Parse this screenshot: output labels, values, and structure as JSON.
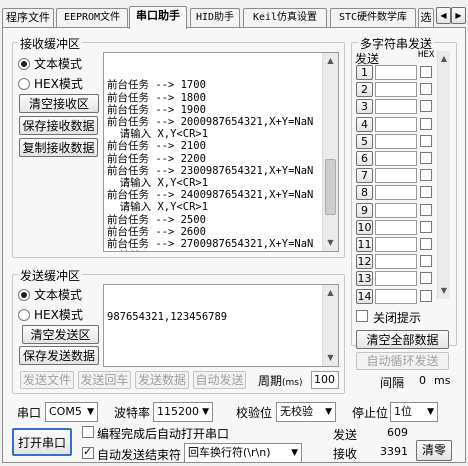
{
  "tabs": [
    "程序文件",
    "EEPROM文件",
    "串口助手",
    "HID助手",
    "Keil仿真设置",
    "STC硬件数学库",
    "选"
  ],
  "tab_nav_arrows": [
    "◀",
    "▶"
  ],
  "receive": {
    "title": "接收缓冲区",
    "mode_text": "文本模式",
    "mode_hex": "HEX模式",
    "clear_label": "清空接收区",
    "save_label": "保存接收数据",
    "copy_label": "复制接收数据",
    "content": "前台任务 --> 1700\n前台任务 --> 1800\n前台任务 --> 1900\n前台任务 --> 2000987654321,X+Y=NaN\n  请输入 X,Y<CR>1\n前台任务 --> 2100\n前台任务 --> 2200\n前台任务 --> 2300987654321,X+Y=NaN\n  请输入 X,Y<CR>1\n前台任务 --> 2400987654321,X+Y=NaN\n  请输入 X,Y<CR>1\n前台任务 --> 2500\n前台任务 --> 2600\n前台任务 --> 2700987654321,X+Y=NaN\n  请输入 X,Y<CR>1\n前台任务 --> 2800"
  },
  "send": {
    "title": "发送缓冲区",
    "mode_text": "文本模式",
    "mode_hex": "HEX模式",
    "clear_label": "清空发送区",
    "save_label": "保存发送数据",
    "content": "987654321,123456789",
    "send_file": "发送文件",
    "send_enter": "发送回车",
    "send_data": "发送数据",
    "auto_send": "自动发送",
    "period_label": "周期",
    "period_unit": "(ms)",
    "period_value": "100"
  },
  "multi": {
    "title": "多字符串发送",
    "col_send": "发送",
    "col_hex": "HEX",
    "rows": [
      "1",
      "2",
      "3",
      "4",
      "5",
      "6",
      "7",
      "8",
      "9",
      "10",
      "11",
      "12",
      "13",
      "14"
    ],
    "close_tip": "关闭提示",
    "clear_all": "清空全部数据",
    "auto_loop": "自动循环发送",
    "interval_label": "间隔",
    "interval_value": "0",
    "interval_unit": "ms"
  },
  "bottom": {
    "port_label": "串口",
    "port_value": "COM5",
    "baud_label": "波特率",
    "baud_value": "115200",
    "parity_label": "校验位",
    "parity_value": "无校验",
    "stop_label": "停止位",
    "stop_value": "1位",
    "open_port": "打开串口",
    "auto_open": "编程完成后自动打开串口",
    "auto_end": "自动发送结束符",
    "end_value": "回车换行符(\\r\\n)",
    "sent_label": "发送",
    "sent_value": "609",
    "recv_label": "接收",
    "recv_value": "3391",
    "clear_count": "清零"
  },
  "scroll_arrows": {
    "up": "▲",
    "down": "▼"
  }
}
